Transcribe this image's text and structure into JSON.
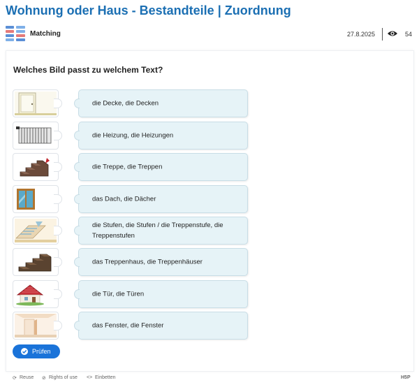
{
  "page": {
    "title": "Wohnung oder Haus - Bestandteile | Zuordnung"
  },
  "meta": {
    "type_label": "Matching",
    "date": "27.8.2025",
    "views": "54"
  },
  "task": {
    "question": "Welches Bild passt zu welchem Text?",
    "images": [
      "door-image",
      "radiator-image",
      "steps-image",
      "window-image",
      "stairwell-image",
      "stairs-image",
      "roof-image",
      "ceiling-image"
    ],
    "texts": [
      "die Decke, die Decken",
      "die Heizung, die Heizungen",
      "die Treppe, die Treppen",
      "das Dach, die Dächer",
      "die Stufen, die Stufen / die Treppenstufe, die Treppenstufen",
      "das Treppenhaus, die Treppenhäuser",
      "die Tür, die Türen",
      "das Fenster, die Fenster"
    ],
    "check_label": "Prüfen"
  },
  "footer": {
    "reuse": "Reuse",
    "rights": "Rights of use",
    "embed": "Einbetten",
    "brand": "H5P"
  },
  "colors": {
    "title": "#1b6fb3",
    "button": "#1a73d9",
    "tile": "#e6f3f7"
  }
}
